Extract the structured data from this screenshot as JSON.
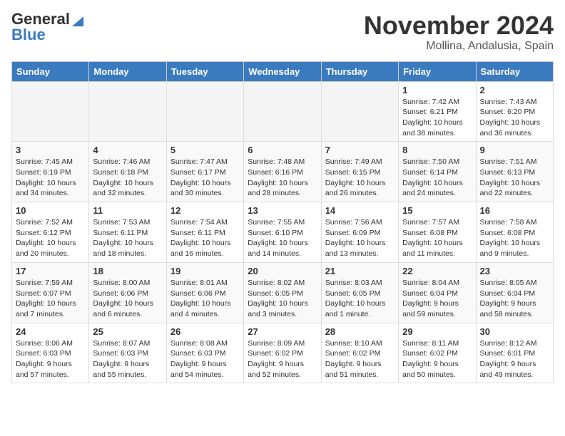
{
  "header": {
    "logo_general": "General",
    "logo_blue": "Blue",
    "month_title": "November 2024",
    "location": "Mollina, Andalusia, Spain"
  },
  "weekdays": [
    "Sunday",
    "Monday",
    "Tuesday",
    "Wednesday",
    "Thursday",
    "Friday",
    "Saturday"
  ],
  "weeks": [
    [
      {
        "day": "",
        "info": ""
      },
      {
        "day": "",
        "info": ""
      },
      {
        "day": "",
        "info": ""
      },
      {
        "day": "",
        "info": ""
      },
      {
        "day": "",
        "info": ""
      },
      {
        "day": "1",
        "info": "Sunrise: 7:42 AM\nSunset: 6:21 PM\nDaylight: 10 hours and 38 minutes."
      },
      {
        "day": "2",
        "info": "Sunrise: 7:43 AM\nSunset: 6:20 PM\nDaylight: 10 hours and 36 minutes."
      }
    ],
    [
      {
        "day": "3",
        "info": "Sunrise: 7:45 AM\nSunset: 6:19 PM\nDaylight: 10 hours and 34 minutes."
      },
      {
        "day": "4",
        "info": "Sunrise: 7:46 AM\nSunset: 6:18 PM\nDaylight: 10 hours and 32 minutes."
      },
      {
        "day": "5",
        "info": "Sunrise: 7:47 AM\nSunset: 6:17 PM\nDaylight: 10 hours and 30 minutes."
      },
      {
        "day": "6",
        "info": "Sunrise: 7:48 AM\nSunset: 6:16 PM\nDaylight: 10 hours and 28 minutes."
      },
      {
        "day": "7",
        "info": "Sunrise: 7:49 AM\nSunset: 6:15 PM\nDaylight: 10 hours and 26 minutes."
      },
      {
        "day": "8",
        "info": "Sunrise: 7:50 AM\nSunset: 6:14 PM\nDaylight: 10 hours and 24 minutes."
      },
      {
        "day": "9",
        "info": "Sunrise: 7:51 AM\nSunset: 6:13 PM\nDaylight: 10 hours and 22 minutes."
      }
    ],
    [
      {
        "day": "10",
        "info": "Sunrise: 7:52 AM\nSunset: 6:12 PM\nDaylight: 10 hours and 20 minutes."
      },
      {
        "day": "11",
        "info": "Sunrise: 7:53 AM\nSunset: 6:11 PM\nDaylight: 10 hours and 18 minutes."
      },
      {
        "day": "12",
        "info": "Sunrise: 7:54 AM\nSunset: 6:11 PM\nDaylight: 10 hours and 16 minutes."
      },
      {
        "day": "13",
        "info": "Sunrise: 7:55 AM\nSunset: 6:10 PM\nDaylight: 10 hours and 14 minutes."
      },
      {
        "day": "14",
        "info": "Sunrise: 7:56 AM\nSunset: 6:09 PM\nDaylight: 10 hours and 13 minutes."
      },
      {
        "day": "15",
        "info": "Sunrise: 7:57 AM\nSunset: 6:08 PM\nDaylight: 10 hours and 11 minutes."
      },
      {
        "day": "16",
        "info": "Sunrise: 7:58 AM\nSunset: 6:08 PM\nDaylight: 10 hours and 9 minutes."
      }
    ],
    [
      {
        "day": "17",
        "info": "Sunrise: 7:59 AM\nSunset: 6:07 PM\nDaylight: 10 hours and 7 minutes."
      },
      {
        "day": "18",
        "info": "Sunrise: 8:00 AM\nSunset: 6:06 PM\nDaylight: 10 hours and 6 minutes."
      },
      {
        "day": "19",
        "info": "Sunrise: 8:01 AM\nSunset: 6:06 PM\nDaylight: 10 hours and 4 minutes."
      },
      {
        "day": "20",
        "info": "Sunrise: 8:02 AM\nSunset: 6:05 PM\nDaylight: 10 hours and 3 minutes."
      },
      {
        "day": "21",
        "info": "Sunrise: 8:03 AM\nSunset: 6:05 PM\nDaylight: 10 hours and 1 minute."
      },
      {
        "day": "22",
        "info": "Sunrise: 8:04 AM\nSunset: 6:04 PM\nDaylight: 9 hours and 59 minutes."
      },
      {
        "day": "23",
        "info": "Sunrise: 8:05 AM\nSunset: 6:04 PM\nDaylight: 9 hours and 58 minutes."
      }
    ],
    [
      {
        "day": "24",
        "info": "Sunrise: 8:06 AM\nSunset: 6:03 PM\nDaylight: 9 hours and 57 minutes."
      },
      {
        "day": "25",
        "info": "Sunrise: 8:07 AM\nSunset: 6:03 PM\nDaylight: 9 hours and 55 minutes."
      },
      {
        "day": "26",
        "info": "Sunrise: 8:08 AM\nSunset: 6:03 PM\nDaylight: 9 hours and 54 minutes."
      },
      {
        "day": "27",
        "info": "Sunrise: 8:09 AM\nSunset: 6:02 PM\nDaylight: 9 hours and 52 minutes."
      },
      {
        "day": "28",
        "info": "Sunrise: 8:10 AM\nSunset: 6:02 PM\nDaylight: 9 hours and 51 minutes."
      },
      {
        "day": "29",
        "info": "Sunrise: 8:11 AM\nSunset: 6:02 PM\nDaylight: 9 hours and 50 minutes."
      },
      {
        "day": "30",
        "info": "Sunrise: 8:12 AM\nSunset: 6:01 PM\nDaylight: 9 hours and 49 minutes."
      }
    ]
  ]
}
